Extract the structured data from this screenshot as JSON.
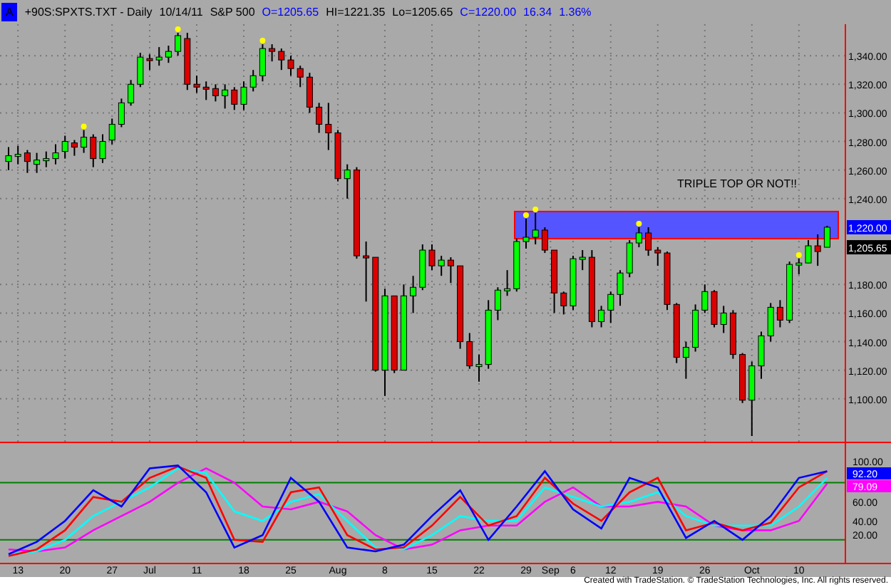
{
  "header": {
    "badge": "A",
    "symbol": "+90S:SPXTS.TXT - Daily",
    "date": "10/14/11",
    "name": "S&P 500",
    "quotes": [
      {
        "text": "O=1205.65",
        "color": "#0000ff"
      },
      {
        "text": "HI=1221.35",
        "color": "#000000"
      },
      {
        "text": "Lo=1205.65",
        "color": "#000000"
      },
      {
        "text": "C=1220.00",
        "color": "#0000ff"
      },
      {
        "text": "16.34",
        "color": "#0000ff"
      },
      {
        "text": "1.36%",
        "color": "#0000ff"
      }
    ]
  },
  "price_panel": {
    "chart_data": {
      "type": "candlestick",
      "ylim": [
        1070,
        1362
      ],
      "grid": true,
      "yticks": [
        {
          "value": 1340,
          "label": "1,340.00"
        },
        {
          "value": 1320,
          "label": "1,320.00"
        },
        {
          "value": 1300,
          "label": "1,300.00"
        },
        {
          "value": 1280,
          "label": "1,280.00"
        },
        {
          "value": 1260,
          "label": "1,260.00"
        },
        {
          "value": 1240,
          "label": "1,240.00"
        },
        {
          "value": 1180,
          "label": "1,180.00"
        },
        {
          "value": 1160,
          "label": "1,160.00"
        },
        {
          "value": 1140,
          "label": "1,140.00"
        },
        {
          "value": 1120,
          "label": "1,120.00"
        },
        {
          "value": 1100,
          "label": "1,100.00"
        }
      ],
      "ohlc": [
        [
          1266,
          1276,
          1260,
          1270
        ],
        [
          1270,
          1277,
          1264,
          1271
        ],
        [
          1272,
          1274,
          1258,
          1266
        ],
        [
          1264,
          1272,
          1258,
          1267
        ],
        [
          1267,
          1273,
          1262,
          1268
        ],
        [
          1268,
          1278,
          1264,
          1272
        ],
        [
          1273,
          1284,
          1268,
          1280
        ],
        [
          1279,
          1281,
          1270,
          1276
        ],
        [
          1276,
          1288,
          1272,
          1283
        ],
        [
          1283,
          1285,
          1262,
          1268
        ],
        [
          1268,
          1285,
          1265,
          1280
        ],
        [
          1281,
          1296,
          1278,
          1292
        ],
        [
          1292,
          1310,
          1290,
          1307
        ],
        [
          1307,
          1323,
          1305,
          1320
        ],
        [
          1320,
          1342,
          1318,
          1339
        ],
        [
          1338,
          1341,
          1330,
          1337
        ],
        [
          1337,
          1346,
          1333,
          1339
        ],
        [
          1339,
          1347,
          1335,
          1343
        ],
        [
          1343,
          1356,
          1340,
          1354
        ],
        [
          1352,
          1356,
          1316,
          1320
        ],
        [
          1320,
          1326,
          1314,
          1318
        ],
        [
          1318,
          1322,
          1309,
          1317
        ],
        [
          1317,
          1320,
          1308,
          1312
        ],
        [
          1312,
          1320,
          1303,
          1316
        ],
        [
          1316,
          1318,
          1302,
          1306
        ],
        [
          1306,
          1322,
          1302,
          1318
        ],
        [
          1318,
          1330,
          1315,
          1326
        ],
        [
          1326,
          1348,
          1322,
          1345
        ],
        [
          1345,
          1348,
          1336,
          1343
        ],
        [
          1343,
          1345,
          1330,
          1337
        ],
        [
          1337,
          1340,
          1326,
          1331
        ],
        [
          1331,
          1333,
          1318,
          1325
        ],
        [
          1325,
          1328,
          1300,
          1304
        ],
        [
          1304,
          1307,
          1286,
          1292
        ],
        [
          1292,
          1307,
          1274,
          1286
        ],
        [
          1286,
          1288,
          1252,
          1254
        ],
        [
          1254,
          1264,
          1240,
          1260
        ],
        [
          1260,
          1262,
          1198,
          1200
        ],
        [
          1200,
          1210,
          1168,
          1199
        ],
        [
          1199,
          1199,
          1119,
          1120
        ],
        [
          1120,
          1177,
          1102,
          1172
        ],
        [
          1172,
          1172,
          1118,
          1120
        ],
        [
          1120,
          1180,
          1120,
          1172
        ],
        [
          1172,
          1186,
          1160,
          1178
        ],
        [
          1178,
          1208,
          1176,
          1204
        ],
        [
          1204,
          1208,
          1190,
          1193
        ],
        [
          1193,
          1200,
          1186,
          1197
        ],
        [
          1197,
          1199,
          1181,
          1193
        ],
        [
          1193,
          1193,
          1135,
          1140
        ],
        [
          1140,
          1146,
          1121,
          1123
        ],
        [
          1123,
          1131,
          1112,
          1124
        ],
        [
          1124,
          1169,
          1121,
          1162
        ],
        [
          1162,
          1178,
          1155,
          1176
        ],
        [
          1176,
          1190,
          1172,
          1177
        ],
        [
          1177,
          1212,
          1175,
          1210
        ],
        [
          1210,
          1226,
          1205,
          1213
        ],
        [
          1213,
          1230,
          1208,
          1218
        ],
        [
          1218,
          1220,
          1202,
          1204
        ],
        [
          1204,
          1204,
          1160,
          1174
        ],
        [
          1174,
          1175,
          1159,
          1165
        ],
        [
          1165,
          1200,
          1162,
          1198
        ],
        [
          1198,
          1204,
          1190,
          1199
        ],
        [
          1199,
          1204,
          1150,
          1154
        ],
        [
          1154,
          1165,
          1150,
          1162
        ],
        [
          1162,
          1175,
          1153,
          1173
        ],
        [
          1173,
          1190,
          1165,
          1188
        ],
        [
          1188,
          1211,
          1185,
          1209
        ],
        [
          1209,
          1220,
          1206,
          1216
        ],
        [
          1216,
          1220,
          1200,
          1204
        ],
        [
          1204,
          1206,
          1193,
          1202
        ],
        [
          1202,
          1203,
          1162,
          1166
        ],
        [
          1166,
          1167,
          1125,
          1129
        ],
        [
          1129,
          1140,
          1114,
          1136
        ],
        [
          1136,
          1166,
          1133,
          1162
        ],
        [
          1162,
          1180,
          1160,
          1175
        ],
        [
          1175,
          1176,
          1150,
          1152
        ],
        [
          1152,
          1165,
          1146,
          1160
        ],
        [
          1160,
          1162,
          1128,
          1131
        ],
        [
          1131,
          1132,
          1097,
          1099
        ],
        [
          1099,
          1126,
          1074,
          1123
        ],
        [
          1123,
          1147,
          1114,
          1144
        ],
        [
          1144,
          1167,
          1140,
          1164
        ],
        [
          1164,
          1169,
          1150,
          1155
        ],
        [
          1155,
          1196,
          1153,
          1194
        ],
        [
          1194,
          1198,
          1187,
          1195
        ],
        [
          1195,
          1211,
          1195,
          1207
        ],
        [
          1207,
          1215,
          1193,
          1203
        ],
        [
          1206,
          1221,
          1206,
          1220
        ]
      ]
    },
    "markers": [
      {
        "text": "1,220.00",
        "kind": "last"
      },
      {
        "text": "1,205.65",
        "kind": "open"
      }
    ],
    "annotation": "TRIPLE TOP OR NOT!!"
  },
  "indicator_panel": {
    "chart_data": {
      "type": "line",
      "ylim": [
        -4,
        123
      ],
      "ref_lines": [
        {
          "axis": "y",
          "value": 80,
          "color": "#008000"
        },
        {
          "axis": "y",
          "value": 20,
          "color": "#008000"
        }
      ],
      "yticks": [
        {
          "value": 100,
          "label": "100.00"
        },
        {
          "value": 60,
          "label": "60.00"
        },
        {
          "value": 40,
          "label": "40.00"
        },
        {
          "value": 20,
          "label": "20.00"
        }
      ],
      "series": [
        {
          "color": "#ff00ff",
          "values": [
            10,
            8,
            12,
            30,
            45,
            60,
            80,
            95,
            80,
            55,
            52,
            60,
            50,
            25,
            10,
            15,
            30,
            35,
            35,
            60,
            75,
            55,
            55,
            60,
            55,
            35,
            30,
            30,
            40,
            79
          ]
        },
        {
          "color": "#00ffff",
          "values": [
            5,
            8,
            20,
            45,
            60,
            75,
            95,
            90,
            50,
            40,
            60,
            68,
            40,
            12,
            10,
            25,
            45,
            40,
            40,
            75,
            65,
            55,
            60,
            70,
            45,
            35,
            35,
            35,
            55,
            85
          ]
        },
        {
          "color": "#ff0000",
          "values": [
            3,
            10,
            30,
            65,
            60,
            85,
            97,
            85,
            20,
            18,
            70,
            75,
            25,
            10,
            12,
            35,
            65,
            35,
            45,
            85,
            58,
            40,
            70,
            85,
            30,
            38,
            30,
            38,
            75,
            92
          ]
        },
        {
          "color": "#0000ff",
          "values": [
            5,
            18,
            40,
            72,
            55,
            95,
            98,
            70,
            12,
            25,
            85,
            60,
            12,
            8,
            15,
            45,
            72,
            20,
            55,
            92,
            52,
            32,
            85,
            75,
            22,
            40,
            20,
            45,
            85,
            92
          ]
        }
      ]
    },
    "markers": [
      {
        "text": "92.20",
        "color": "#0000ff"
      },
      {
        "text": "79.09",
        "color": "#ff00ff"
      }
    ]
  },
  "x_axis": [
    "13",
    "20",
    "27",
    "Jul",
    "11",
    "18",
    "25",
    "Aug",
    "8",
    "15",
    "22",
    "29",
    "Sep",
    "6",
    "12",
    "19",
    "26",
    "Oct",
    "10"
  ],
  "footer": "Created with TradeStation. © TradeStation Technologies, Inc. All rights reserved."
}
